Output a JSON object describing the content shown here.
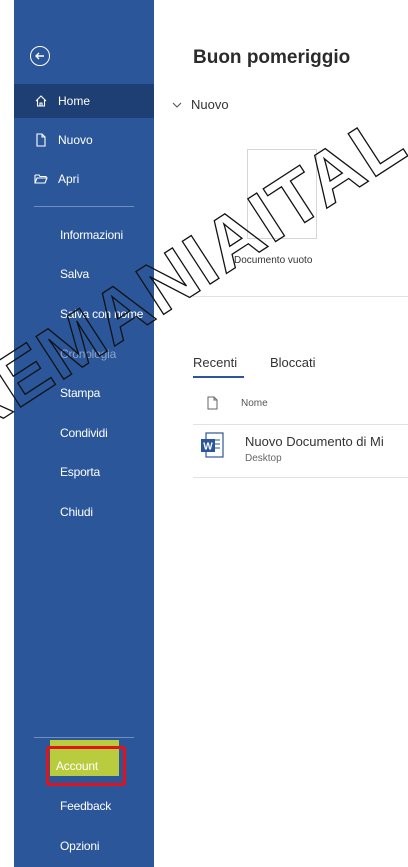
{
  "sidebar": {
    "back_icon": "back-arrow-icon",
    "nav": [
      {
        "label": "Home",
        "icon": "home-icon",
        "active": true
      },
      {
        "label": "Nuovo",
        "icon": "new-document-icon"
      },
      {
        "label": "Apri",
        "icon": "open-folder-icon"
      }
    ],
    "items": [
      {
        "label": "Informazioni"
      },
      {
        "label": "Salva"
      },
      {
        "label": "Salva con nome"
      },
      {
        "label": "Cronologia",
        "disabled": true
      },
      {
        "label": "Stampa"
      },
      {
        "label": "Condividi"
      },
      {
        "label": "Esporta"
      },
      {
        "label": "Chiudi"
      }
    ],
    "bottom": [
      {
        "label": "Account"
      },
      {
        "label": "Feedback"
      },
      {
        "label": "Opzioni"
      }
    ]
  },
  "main": {
    "greeting": "Buon pomeriggio",
    "new_section": "Nuovo",
    "blank_template": "Documento vuoto",
    "tabs": [
      {
        "label": "Recenti",
        "active": true
      },
      {
        "label": "Bloccati"
      }
    ],
    "list_header": {
      "name": "Nome"
    },
    "files": [
      {
        "name": "Nuovo Documento di Mi",
        "location": "Desktop",
        "icon": "word-document-icon"
      }
    ]
  },
  "watermark": {
    "text": "REMANIAITAL"
  },
  "colors": {
    "sidebar": "#2b579a",
    "active_nav": "#1e3f73",
    "highlight": "#c6d636",
    "annotation_border": "#e0141b"
  }
}
